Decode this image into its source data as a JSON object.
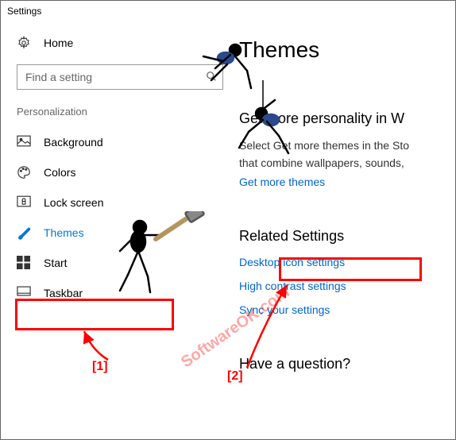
{
  "window": {
    "title": "Settings"
  },
  "sidebar": {
    "home_label": "Home",
    "search_placeholder": "Find a setting",
    "section_label": "Personalization",
    "items": [
      {
        "label": "Background"
      },
      {
        "label": "Colors"
      },
      {
        "label": "Lock screen"
      },
      {
        "label": "Themes"
      },
      {
        "label": "Start"
      },
      {
        "label": "Taskbar"
      }
    ]
  },
  "content": {
    "title": "Themes",
    "personality_head": "Get more personality in W",
    "personality_body1": "Select Get more themes in the Sto",
    "personality_body2": "that combine wallpapers, sounds,",
    "get_more_link": "Get more themes",
    "related_head": "Related Settings",
    "related_links": {
      "desktop_icons": "Desktop icon settings",
      "high_contrast": "High contrast settings",
      "sync": "Sync your settings"
    },
    "question_head": "Have a question?"
  },
  "annotations": {
    "label1": "[1]",
    "label2": "[2]",
    "watermark": "SoftwareOK.com"
  }
}
